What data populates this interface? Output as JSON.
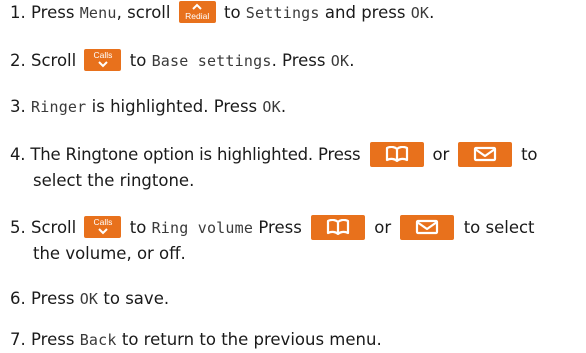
{
  "steps": [
    {
      "num": "1.",
      "t1": "Press",
      "lcd1": "Menu",
      "t2": ", scroll",
      "key": "Redial",
      "t3": "to",
      "lcd2": "Settings",
      "t4": "and press",
      "lcd3": "OK",
      "t5": "."
    },
    {
      "num": "2.",
      "t1": "Scroll",
      "key": "Calls",
      "t2": "to",
      "lcd1": "Base settings",
      "t3": ". Press",
      "lcd2": "OK",
      "t4": "."
    },
    {
      "num": "3.",
      "lcd1": "Ringer",
      "t1": "is highlighted. Press",
      "lcd2": "OK",
      "t2": "."
    },
    {
      "num": "4.",
      "t1": "The Ringtone option is highlighted. Press",
      "t2": "or",
      "t3": "to",
      "line2": "select the ringtone."
    },
    {
      "num": "5.",
      "t1": "Scroll",
      "key": "Calls",
      "t2": "to",
      "lcd1": "Ring volume",
      "t3": "Press",
      "t4": "or",
      "t5": "to select",
      "line2": "the volume, or off."
    },
    {
      "num": "6.",
      "t1": "Press",
      "lcd1": "OK",
      "t2": "to save."
    },
    {
      "num": "7.",
      "t1": "Press",
      "lcd1": "Back",
      "t2": "to return to the previous menu."
    }
  ],
  "colors": {
    "key": "#e8711c",
    "text": "#1a1a1a"
  },
  "icons": [
    "up-arrow-icon",
    "down-arrow-icon",
    "phonebook-icon",
    "envelope-icon"
  ]
}
